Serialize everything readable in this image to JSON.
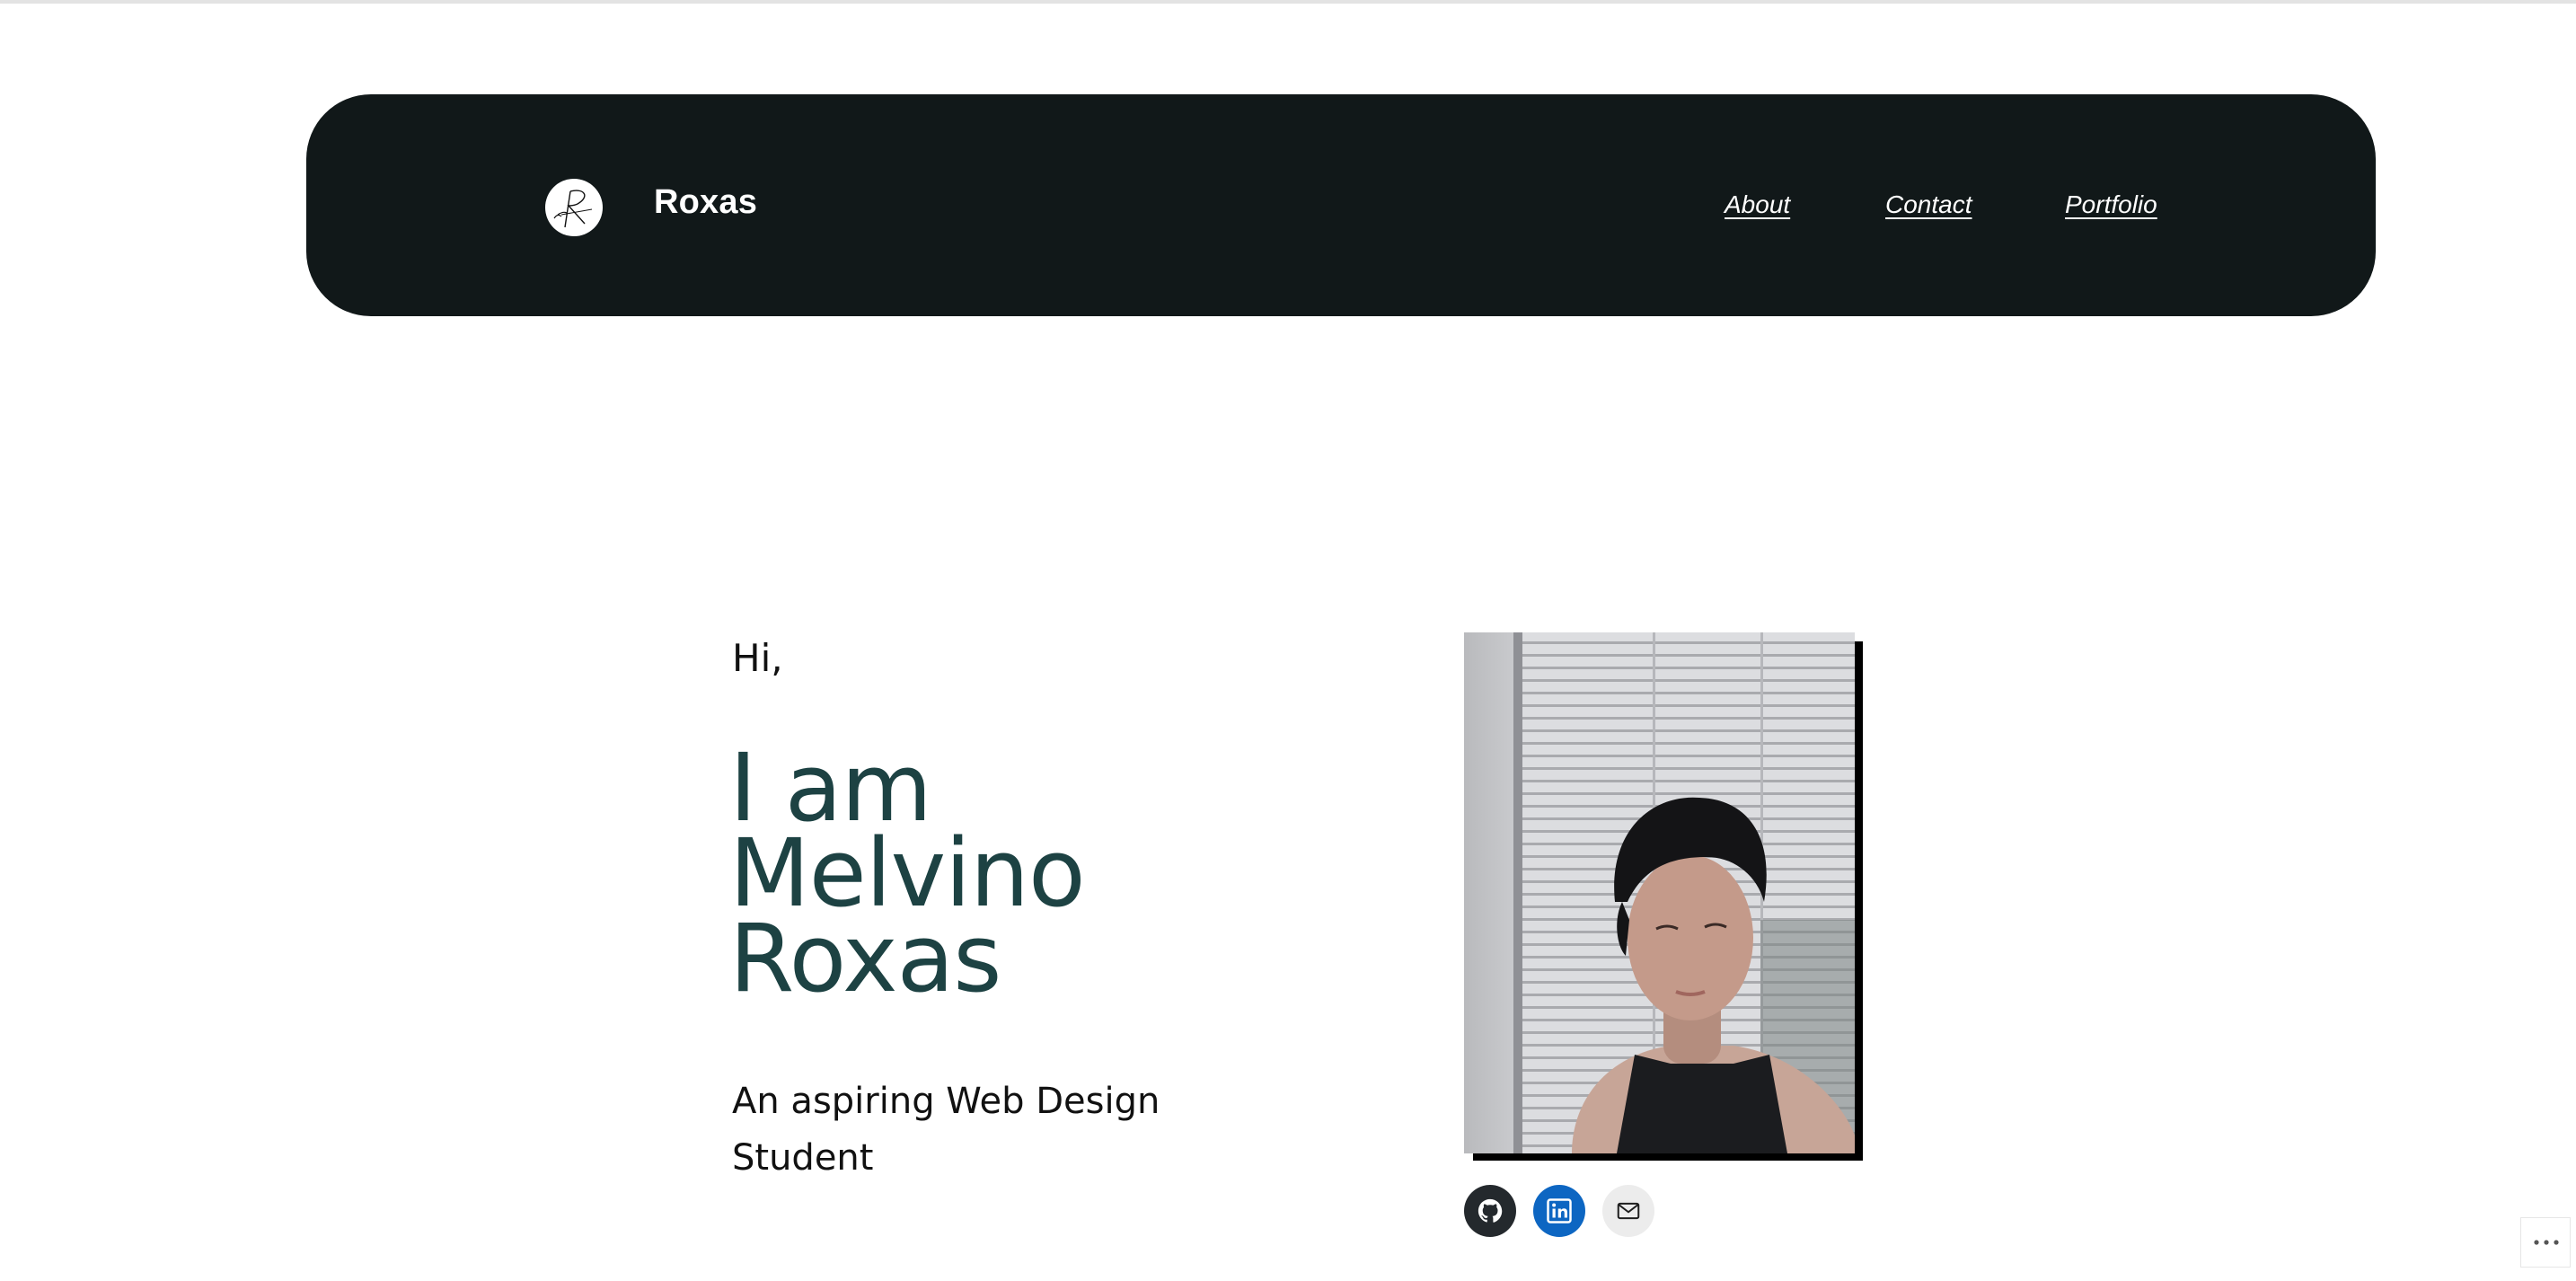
{
  "header": {
    "site_title": "Roxas",
    "logo_icon": "signature-logo-icon",
    "nav": [
      {
        "label": "About"
      },
      {
        "label": "Contact"
      },
      {
        "label": "Portfolio"
      }
    ],
    "background_color": "#111819"
  },
  "hero": {
    "greeting": "Hi,",
    "title_lines": [
      "I am",
      "Melvino",
      "Roxas"
    ],
    "title_color": "#1d4243",
    "subtitle": "An aspiring Web Design Student"
  },
  "profile_photo": {
    "icon": "portrait-photo"
  },
  "social_links": [
    {
      "icon": "github-icon",
      "color": "#24292d"
    },
    {
      "icon": "linkedin-icon",
      "color": "#0d66c2"
    },
    {
      "icon": "mail-icon",
      "color": "#ececec"
    }
  ],
  "more_options": {
    "icon": "ellipsis-icon"
  }
}
